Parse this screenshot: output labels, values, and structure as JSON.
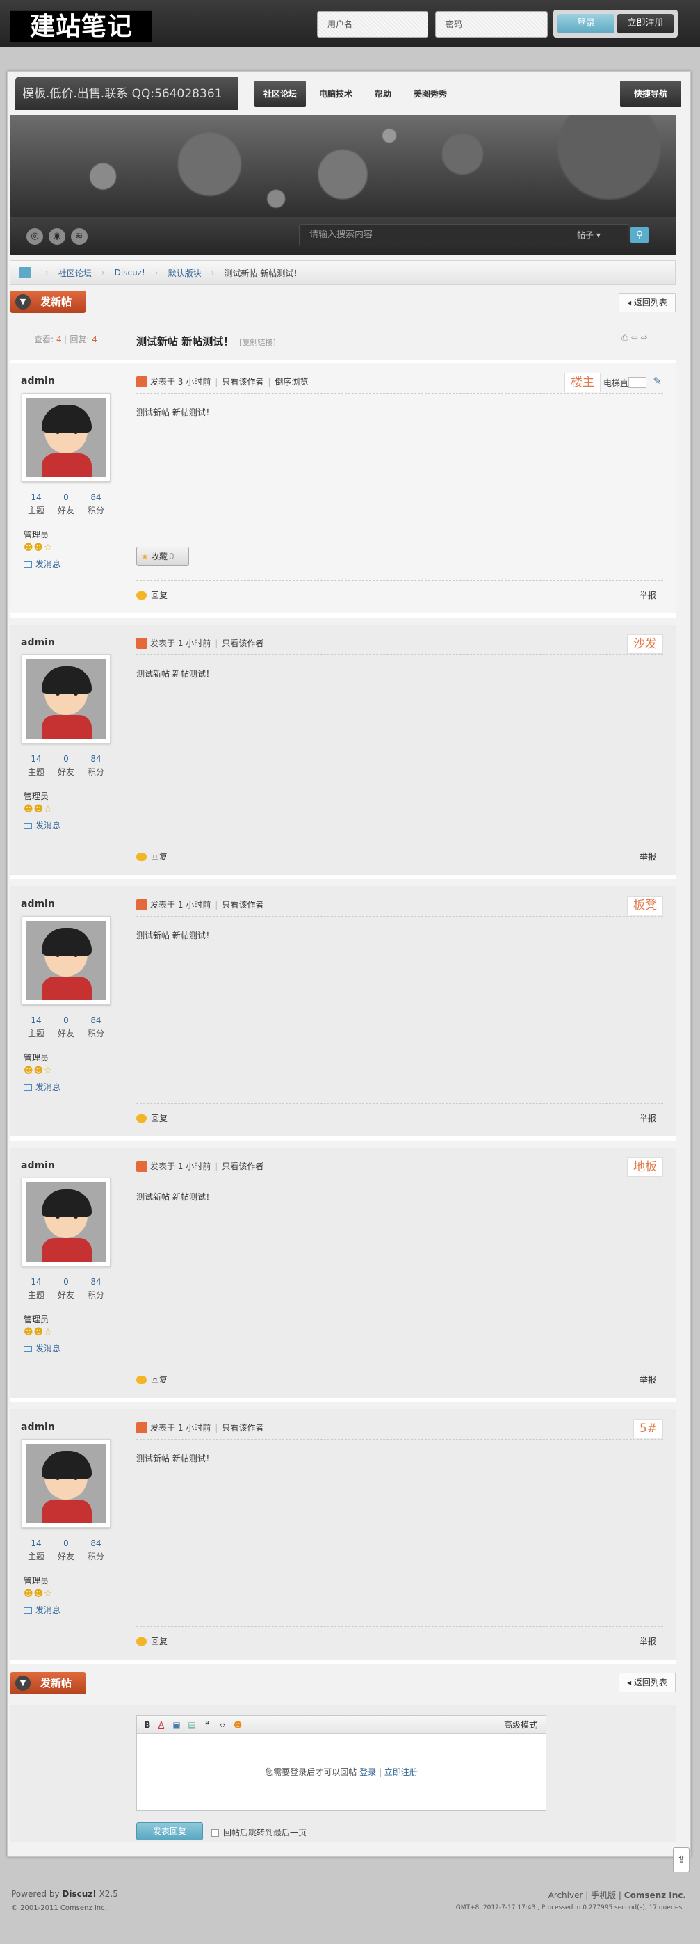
{
  "topbar": {
    "logo": "建站笔记",
    "username_placeholder": "用户名",
    "password_placeholder": "密码",
    "login": "登录",
    "register": "立即注册"
  },
  "nav": {
    "slogan": "模板.低价.出售.联系 QQ:564028361",
    "items": [
      "社区论坛",
      "电脑技术",
      "帮助",
      "美图秀秀"
    ],
    "quick": "快捷导航"
  },
  "search": {
    "placeholder": "请输入搜索内容",
    "type": "帖子"
  },
  "breadcrumb": [
    "社区论坛",
    "Discuz!",
    "默认版块",
    "测试新帖 新帖测试！"
  ],
  "actions": {
    "new_post": "发新帖",
    "back": "返回列表"
  },
  "thread": {
    "views_label": "查看:",
    "views": "4",
    "replies_label": "回复:",
    "replies": "4",
    "title": "测试新帖 新帖测试！",
    "copy_link": "[复制链接]"
  },
  "labels": {
    "threads": "主题",
    "friends": "好友",
    "credits": "积分",
    "group": "管理员",
    "send_msg": "发消息",
    "only_author": "只看该作者",
    "reverse": "倒序浏览",
    "jump": "电梯直达",
    "favorite": "收藏",
    "fav_count": "0",
    "reply": "回复",
    "report": "举报"
  },
  "posts": [
    {
      "author": "admin",
      "threads": "14",
      "friends": "0",
      "credits": "84",
      "time": "发表于 3 小时前",
      "floor": "楼主",
      "content": "测试新帖  新帖测试！"
    },
    {
      "author": "admin",
      "threads": "14",
      "friends": "0",
      "credits": "84",
      "time": "发表于 1 小时前",
      "floor": "沙发",
      "content": "测试新帖  新帖测试！"
    },
    {
      "author": "admin",
      "threads": "14",
      "friends": "0",
      "credits": "84",
      "time": "发表于 1 小时前",
      "floor": "板凳",
      "content": "测试新帖  新帖测试！"
    },
    {
      "author": "admin",
      "threads": "14",
      "friends": "0",
      "credits": "84",
      "time": "发表于 1 小时前",
      "floor": "地板",
      "content": "测试新帖  新帖测试！"
    },
    {
      "author": "admin",
      "threads": "14",
      "friends": "0",
      "credits": "84",
      "time": "发表于 1 小时前",
      "floor": "5#",
      "content": "测试新帖  新帖测试！"
    }
  ],
  "reply": {
    "advanced": "高级模式",
    "login_hint": "您需要登录后才可以回帖",
    "login": "登录",
    "register": "立即注册",
    "submit": "发表回复",
    "jump_last": "回帖后跳转到最后一页"
  },
  "footer": {
    "powered": "Powered by",
    "product": "Discuz!",
    "version": "X2.5",
    "copyright": "© 2001-2011 Comsenz Inc.",
    "archiver": "Archiver",
    "mobile": "手机版",
    "company": "Comsenz Inc.",
    "stats": "GMT+8, 2012-7-17 17:43 , Processed in 0.277995 second(s), 17 queries ."
  },
  "colors": {
    "accent": "#d2572c",
    "link": "#336699",
    "login_btn": "#6db6cd"
  }
}
